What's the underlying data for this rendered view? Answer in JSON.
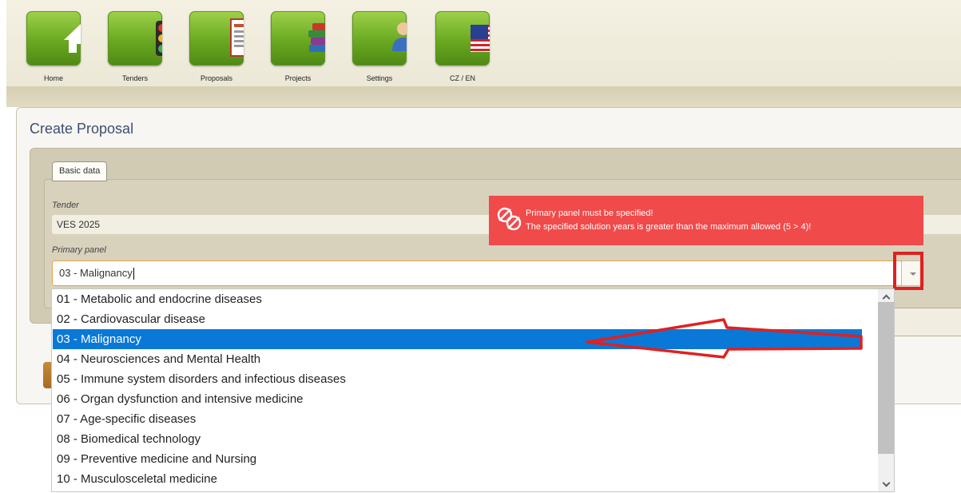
{
  "nav": {
    "items": [
      {
        "label": "Home",
        "icon": "home-icon"
      },
      {
        "label": "Tenders",
        "icon": "traffic-light-icon"
      },
      {
        "label": "Proposals",
        "icon": "document-icon"
      },
      {
        "label": "Projects",
        "icon": "books-icon"
      },
      {
        "label": "Settings",
        "icon": "user-wrench-icon"
      },
      {
        "label": "CZ / EN",
        "icon": "us-flag-icon"
      }
    ]
  },
  "page": {
    "title": "Create Proposal",
    "section_tab": "Basic data"
  },
  "form": {
    "tender_label": "Tender",
    "tender_value": "VES 2025",
    "primary_panel_label": "Primary panel",
    "primary_panel_value": "03 - Malignancy"
  },
  "errors": {
    "line1": "Primary panel must be specified!",
    "line2": "The specified solution years is greater than the maximum allowed (5 > 4)!"
  },
  "dropdown": {
    "selected_index": 2,
    "options": [
      "01 - Metabolic and endocrine diseases",
      "02 - Cardiovascular disease",
      "03 - Malignancy",
      "04 - Neurosciences and Mental Health",
      "05 - Immune system disorders and infectious diseases",
      "06 - Organ dysfunction and intensive medicine",
      "07 - Age-specific diseases",
      "08 - Biomedical technology",
      "09 - Preventive medicine and Nursing",
      "10 - Musculosceletal medicine"
    ]
  },
  "colors": {
    "nav_tile": "#6aa821",
    "error_bg": "#f04a4a",
    "selection": "#0a78d7",
    "annotation": "#e02020"
  }
}
